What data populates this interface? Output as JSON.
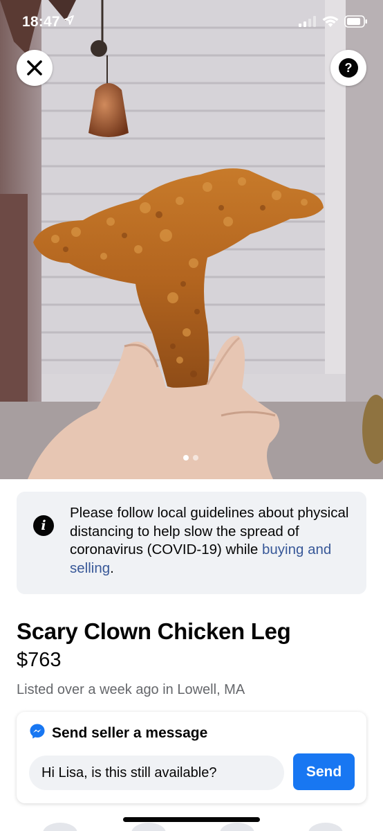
{
  "status_bar": {
    "time": "18:47"
  },
  "listing": {
    "photo_pages": 2,
    "photo_current_index": 1,
    "title": "Scary Clown Chicken Leg",
    "price": "$763",
    "meta": "Listed over a week ago in Lowell, MA"
  },
  "notice": {
    "text": "Please follow local guidelines about physical distancing to help slow the spread of coronavirus (COVID-19) while ",
    "link": "buying and selling",
    "end": "."
  },
  "message": {
    "header": "Send seller a message",
    "input_value": "Hi Lisa, is this still available?",
    "send_label": "Send"
  },
  "colors": {
    "accent": "#1877f2",
    "link": "#385898",
    "notice_bg": "#f0f2f5",
    "muted": "#65676b"
  },
  "icons": [
    "close-icon",
    "help-icon",
    "info-icon",
    "messenger-icon",
    "location-arrow-icon",
    "signal-icon",
    "wifi-icon",
    "battery-icon"
  ]
}
